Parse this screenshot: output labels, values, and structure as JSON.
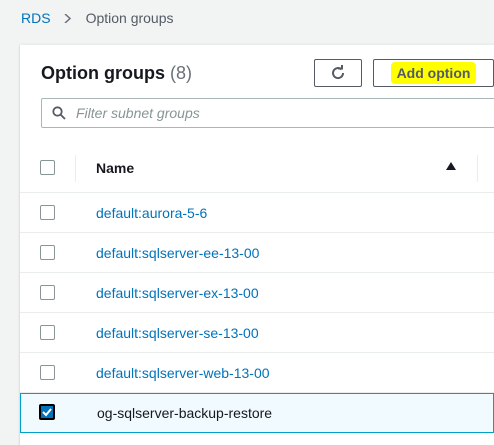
{
  "breadcrumb": {
    "root": "RDS",
    "current": "Option groups"
  },
  "panel": {
    "title": "Option groups",
    "count": "(8)",
    "add_button_label": "Add option",
    "highlight_color": "#ffff00"
  },
  "search": {
    "placeholder": "Filter subnet groups",
    "value": ""
  },
  "table": {
    "columns": [
      "Name"
    ],
    "sort": "ascending",
    "rows": [
      {
        "name": "default:aurora-5-6",
        "selected": false
      },
      {
        "name": "default:sqlserver-ee-13-00",
        "selected": false
      },
      {
        "name": "default:sqlserver-ex-13-00",
        "selected": false
      },
      {
        "name": "default:sqlserver-se-13-00",
        "selected": false
      },
      {
        "name": "default:sqlserver-web-13-00",
        "selected": false
      },
      {
        "name": "og-sqlserver-backup-restore",
        "selected": true
      }
    ]
  },
  "colors": {
    "link": "#0073bb",
    "selected_border": "#00a1c9",
    "selected_bg": "#f1faff"
  },
  "icons": [
    "chevron-right-icon",
    "refresh-icon",
    "search-icon",
    "sort-ascending-icon",
    "checkbox-checked-icon"
  ]
}
